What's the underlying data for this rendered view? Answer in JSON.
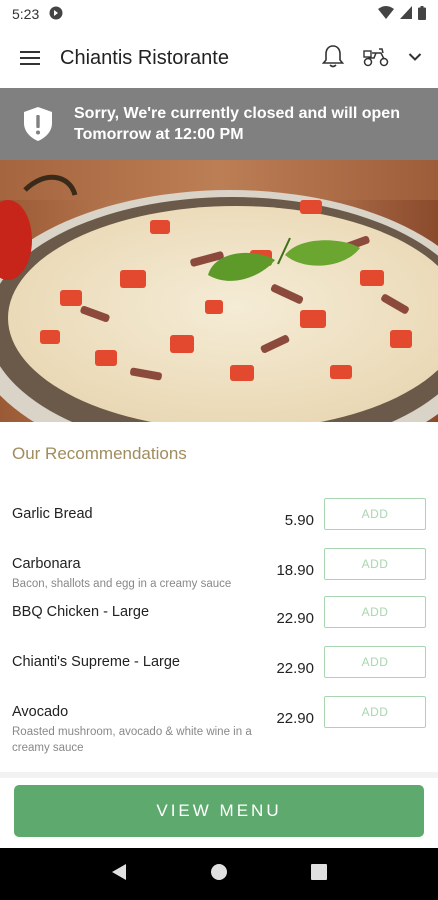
{
  "status": {
    "time": "5:23"
  },
  "app_bar": {
    "title": "Chiantis Ristorante"
  },
  "banner": {
    "line1": "Sorry, We're currently closed and will open",
    "line2": "Tomorrow at 12:00 PM"
  },
  "recommendations": {
    "heading": "Our Recommendations",
    "items": [
      {
        "name": "Garlic Bread",
        "desc": "",
        "price": "5.90",
        "add": "ADD"
      },
      {
        "name": "Carbonara",
        "desc": "Bacon, shallots and egg in a creamy sauce",
        "price": "18.90",
        "add": "ADD"
      },
      {
        "name": "BBQ Chicken - Large",
        "desc": "",
        "price": "22.90",
        "add": "ADD"
      },
      {
        "name": "Chianti's Supreme - Large",
        "desc": "",
        "price": "22.90",
        "add": "ADD"
      },
      {
        "name": "Avocado",
        "desc": "Roasted mushroom, avocado & white wine in a creamy sauce",
        "price": "22.90",
        "add": "ADD"
      }
    ]
  },
  "view_menu_label": "VIEW MENU",
  "colors": {
    "accent_green": "#5eaa6e",
    "add_border": "#a9d6b0",
    "heading_gold": "#a08c5e",
    "banner_gray": "#808080"
  }
}
